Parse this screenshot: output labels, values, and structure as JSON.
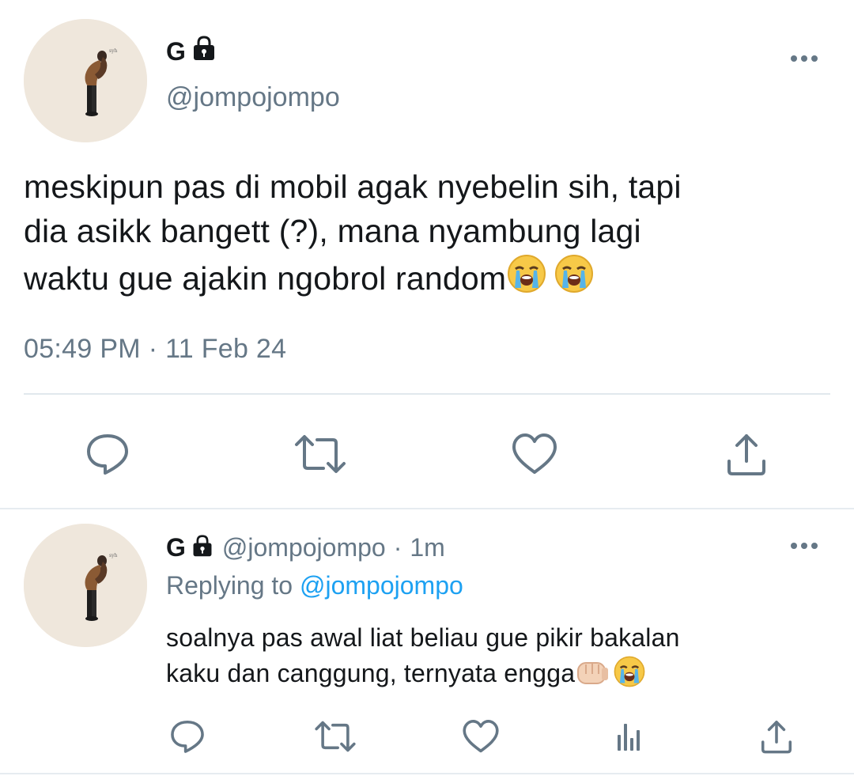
{
  "main_tweet": {
    "display_name": "G",
    "handle": "@jompojompo",
    "text_lines": [
      "meskipun pas di mobil agak nyebelin sih, tapi",
      "dia asikk bangett (?), mana nyambung lagi",
      "waktu gue ajakin ngobrol random"
    ],
    "emoji": [
      "loudly-crying-face",
      "loudly-crying-face"
    ],
    "time": "05:49 PM",
    "separator": "·",
    "date": "11 Feb 24",
    "actions": [
      "reply-icon",
      "retweet-icon",
      "like-icon",
      "share-icon"
    ]
  },
  "reply": {
    "display_name": "G",
    "handle": "@jompojompo",
    "separator": "·",
    "age": "1m",
    "replying_label": "Replying to",
    "replying_handle": "@jompojompo",
    "text_lines": [
      "soalnya pas awal liat beliau gue pikir bakalan",
      "kaku dan canggung, ternyata engga"
    ],
    "emoji": [
      "oncoming-fist",
      "loudly-crying-face"
    ],
    "actions": [
      "reply-icon",
      "retweet-icon",
      "like-icon",
      "analytics-icon",
      "share-icon"
    ]
  },
  "colors": {
    "text": "#14171a",
    "secondary": "#657786",
    "link": "#1da1f2",
    "divider": "#e1e8ed"
  }
}
